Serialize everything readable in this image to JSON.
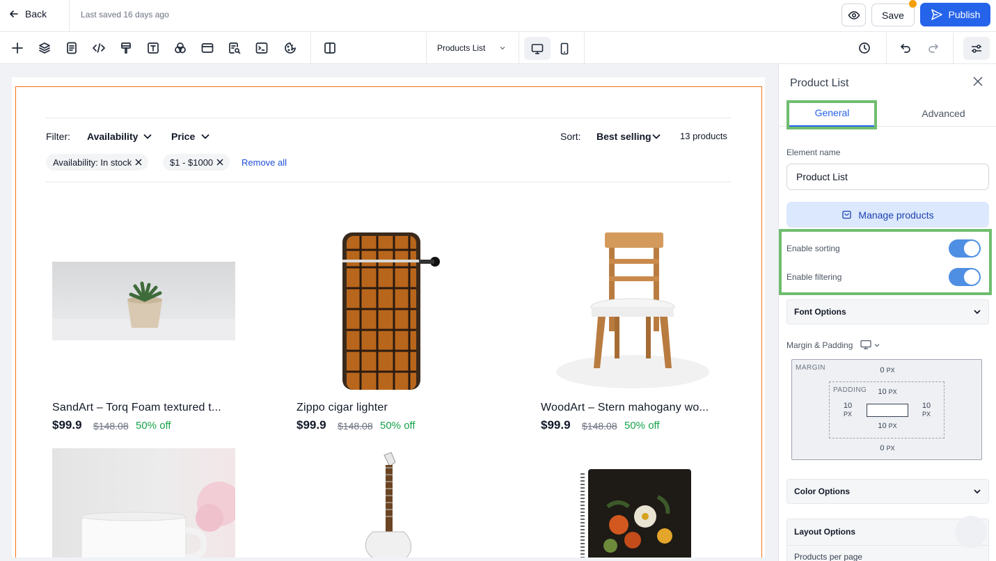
{
  "header": {
    "back_label": "Back",
    "saved_text": "Last saved 16 days ago",
    "save_label": "Save",
    "publish_label": "Publish"
  },
  "toolbar": {
    "tools": [
      "add-icon",
      "layers-icon",
      "page-icon",
      "code-icon",
      "brush-icon",
      "text-icon",
      "shapes-icon",
      "section-icon",
      "search-page-icon",
      "terminal-icon",
      "cookie-icon",
      "columns-icon"
    ],
    "page_selector": "Products List",
    "devices": [
      "desktop",
      "mobile"
    ],
    "right_icons": [
      "history-icon",
      "undo-icon",
      "redo-icon",
      "settings-sliders-icon"
    ]
  },
  "canvas": {
    "filter_label": "Filter:",
    "filter_availability": "Availability",
    "filter_price": "Price",
    "sort_label": "Sort:",
    "sort_value": "Best selling",
    "product_count": "13 products",
    "chips": [
      "Availability: In stock",
      "$1 - $1000"
    ],
    "remove_all": "Remove all",
    "products": [
      {
        "title": "SandArt – Torq Foam textured t...",
        "price": "$99.9",
        "old_price": "$148.08",
        "discount": "50% off"
      },
      {
        "title": "Zippo cigar lighter",
        "price": "$99.9",
        "old_price": "$148.08",
        "discount": "50% off"
      },
      {
        "title": "WoodArt – Stern mahogany wo...",
        "price": "$99.9",
        "old_price": "$148.08",
        "discount": "50% off"
      }
    ]
  },
  "panel": {
    "title": "Product List",
    "tab_general": "General",
    "tab_advanced": "Advanced",
    "element_name_label": "Element name",
    "element_name_value": "Product List",
    "manage_products": "Manage products",
    "enable_sorting": "Enable sorting",
    "enable_filtering": "Enable filtering",
    "sorting_on": true,
    "filtering_on": true,
    "font_options": "Font Options",
    "margin_padding": "Margin & Padding",
    "margin_label": "MARGIN",
    "padding_label": "PADDING",
    "margin_top": "0",
    "margin_bottom": "0",
    "padding_top": "10",
    "padding_bottom": "10",
    "padding_left": "10",
    "padding_right": "10",
    "unit": "PX",
    "color_options": "Color Options",
    "layout_options": "Layout Options",
    "products_per_page": "Products per page"
  },
  "colors": {
    "accent": "#2563eb",
    "selection": "#f97316",
    "highlight": "#6fbd6f",
    "discount": "#16a34a"
  }
}
